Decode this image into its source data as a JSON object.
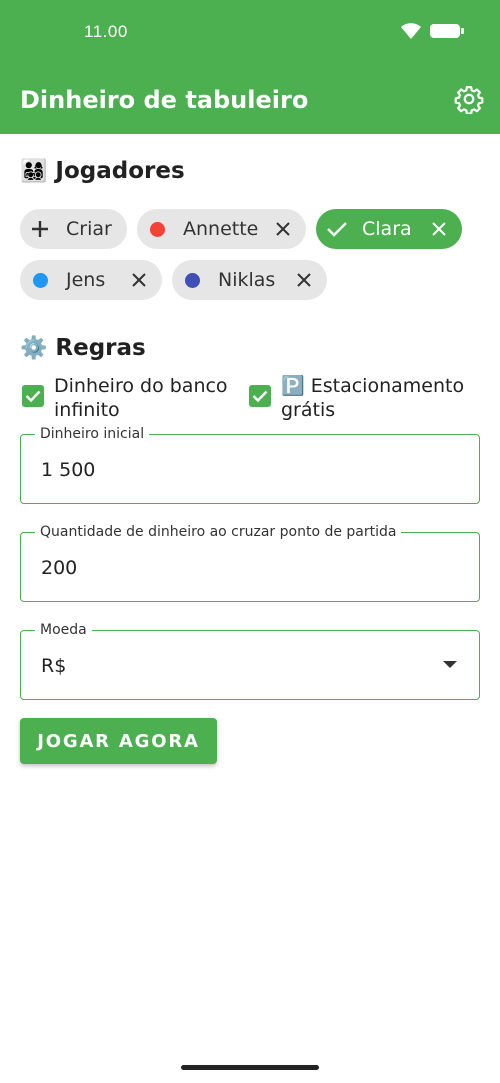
{
  "status": {
    "time": "11.00"
  },
  "app_bar": {
    "title": "Dinheiro de tabuleiro"
  },
  "players": {
    "section_emoji": "👨‍👩‍👧‍👦",
    "title": "Jogadores",
    "create_label": "Criar",
    "chips": [
      {
        "name": "Annette",
        "color": "#F44336",
        "selected": false
      },
      {
        "name": "Clara",
        "color": "#4CAF50",
        "selected": true
      },
      {
        "name": "Jens",
        "color": "#2196F3",
        "selected": false
      },
      {
        "name": "Niklas",
        "color": "#3F51B5",
        "selected": false
      }
    ]
  },
  "rules": {
    "section_emoji": "⚙️",
    "title": "Regras",
    "infinite_bank_line1": "Dinheiro do banco",
    "infinite_bank_line2": "infinito",
    "infinite_bank_checked": true,
    "free_parking_emoji": "🅿️",
    "free_parking_line1": "Estacionamento",
    "free_parking_line2": "grátis",
    "free_parking_checked": true
  },
  "fields": {
    "initial_money": {
      "label": "Dinheiro inicial",
      "value": "1 500"
    },
    "pass_go": {
      "label": "Quantidade de dinheiro ao cruzar ponto de partida",
      "value": "200"
    },
    "currency": {
      "label": "Moeda",
      "value": "R$"
    }
  },
  "actions": {
    "play_label": "JOGAR AGORA"
  },
  "colors": {
    "primary": "#4CAF50"
  }
}
